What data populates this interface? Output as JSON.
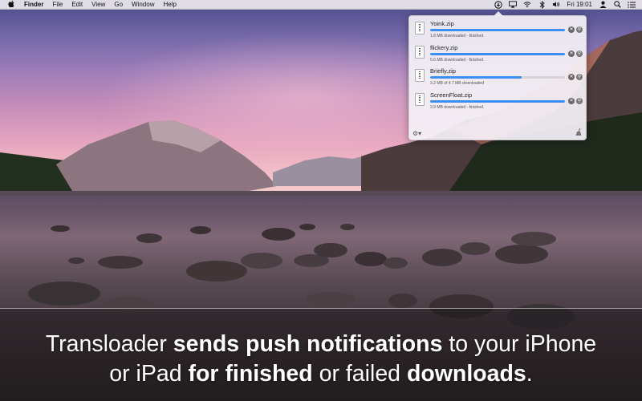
{
  "menubar": {
    "apple_icon": "apple-logo",
    "items": [
      "Finder",
      "File",
      "Edit",
      "View",
      "Go",
      "Window",
      "Help"
    ],
    "status_icons": [
      "transloader-icon",
      "airplay-icon",
      "wifi-icon",
      "bluetooth-icon",
      "volume-icon"
    ],
    "clock": "Fri 19:01",
    "right_icons": [
      "user-icon",
      "spotlight-search-icon",
      "notification-center-icon"
    ]
  },
  "downloads": [
    {
      "name": "Yoink.zip",
      "progress": 1.0,
      "status": "1.8 MB downloaded - finished."
    },
    {
      "name": "flickery.zip",
      "progress": 1.0,
      "status": "5.6 MB downloaded - finished."
    },
    {
      "name": "Briefly.zip",
      "progress": 0.68,
      "status": "3.2 MB of 4.7 MB downloaded"
    },
    {
      "name": "ScreenFloat.zip",
      "progress": 1.0,
      "status": "3.9 MB downloaded - finished."
    }
  ],
  "popover_footer": {
    "left_icon": "gear-icon",
    "right_icon": "broom-icon"
  },
  "caption": {
    "p1": "Transloader ",
    "p2": "sends push notifications",
    "p3": " to your iPhone",
    "p4": "or iPad ",
    "p5": "for finished",
    "p6": " or failed ",
    "p7": "downloads",
    "p8": "."
  },
  "colors": {
    "progress": "#3a8ff0",
    "menubar": "#ece8ee"
  }
}
